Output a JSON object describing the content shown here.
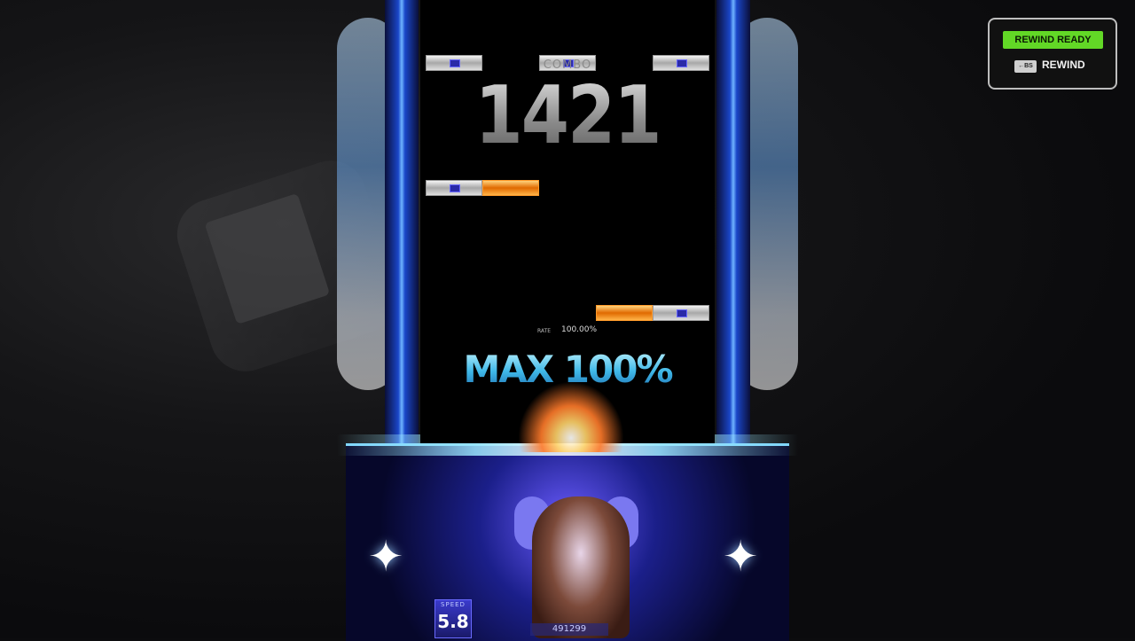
{
  "hud": {
    "combo_label": "COMBO",
    "combo_value": "1421",
    "rate_label": "RATE",
    "rate_value": "100.00%",
    "judgement_text": "MAX 100%",
    "speed_label": "SPEED",
    "speed_value": "5.8",
    "score_value": "491299"
  },
  "rewind": {
    "ready_label": "REWIND READY",
    "key_label": "←BS",
    "action_label": "REWIND"
  },
  "icons": [
    "sparkle-star-icon",
    "note-gem-icon"
  ],
  "colors": {
    "rewind_ready_bg": "#62d826",
    "judgement": "#3fb8e8",
    "hold_note": "#e06a00",
    "lane_bg": "#000000",
    "frame_accent": "#1a46c8"
  }
}
